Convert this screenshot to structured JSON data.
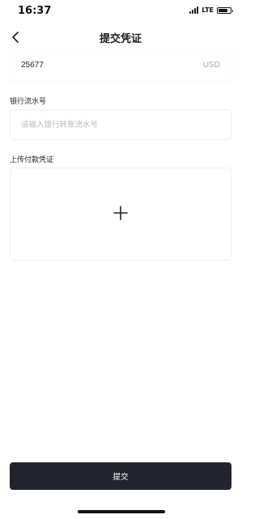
{
  "status_bar": {
    "time": "16:37",
    "network": "LTE",
    "icons": [
      "signal-icon",
      "battery-icon"
    ]
  },
  "nav": {
    "title": "提交凭证",
    "back_icon": "chevron-left-icon"
  },
  "amount": {
    "value": "25677",
    "unit": "USD"
  },
  "serial": {
    "label": "银行流水号",
    "placeholder": "请输入银行转账流水号",
    "value": ""
  },
  "upload": {
    "label": "上传付款凭证",
    "icon": "plus-icon"
  },
  "submit": {
    "label": "提交"
  },
  "colors": {
    "primary": "#21232f",
    "placeholder": "#b7b9c1",
    "muted": "#a5a8b2",
    "border": "#eeeff2"
  }
}
